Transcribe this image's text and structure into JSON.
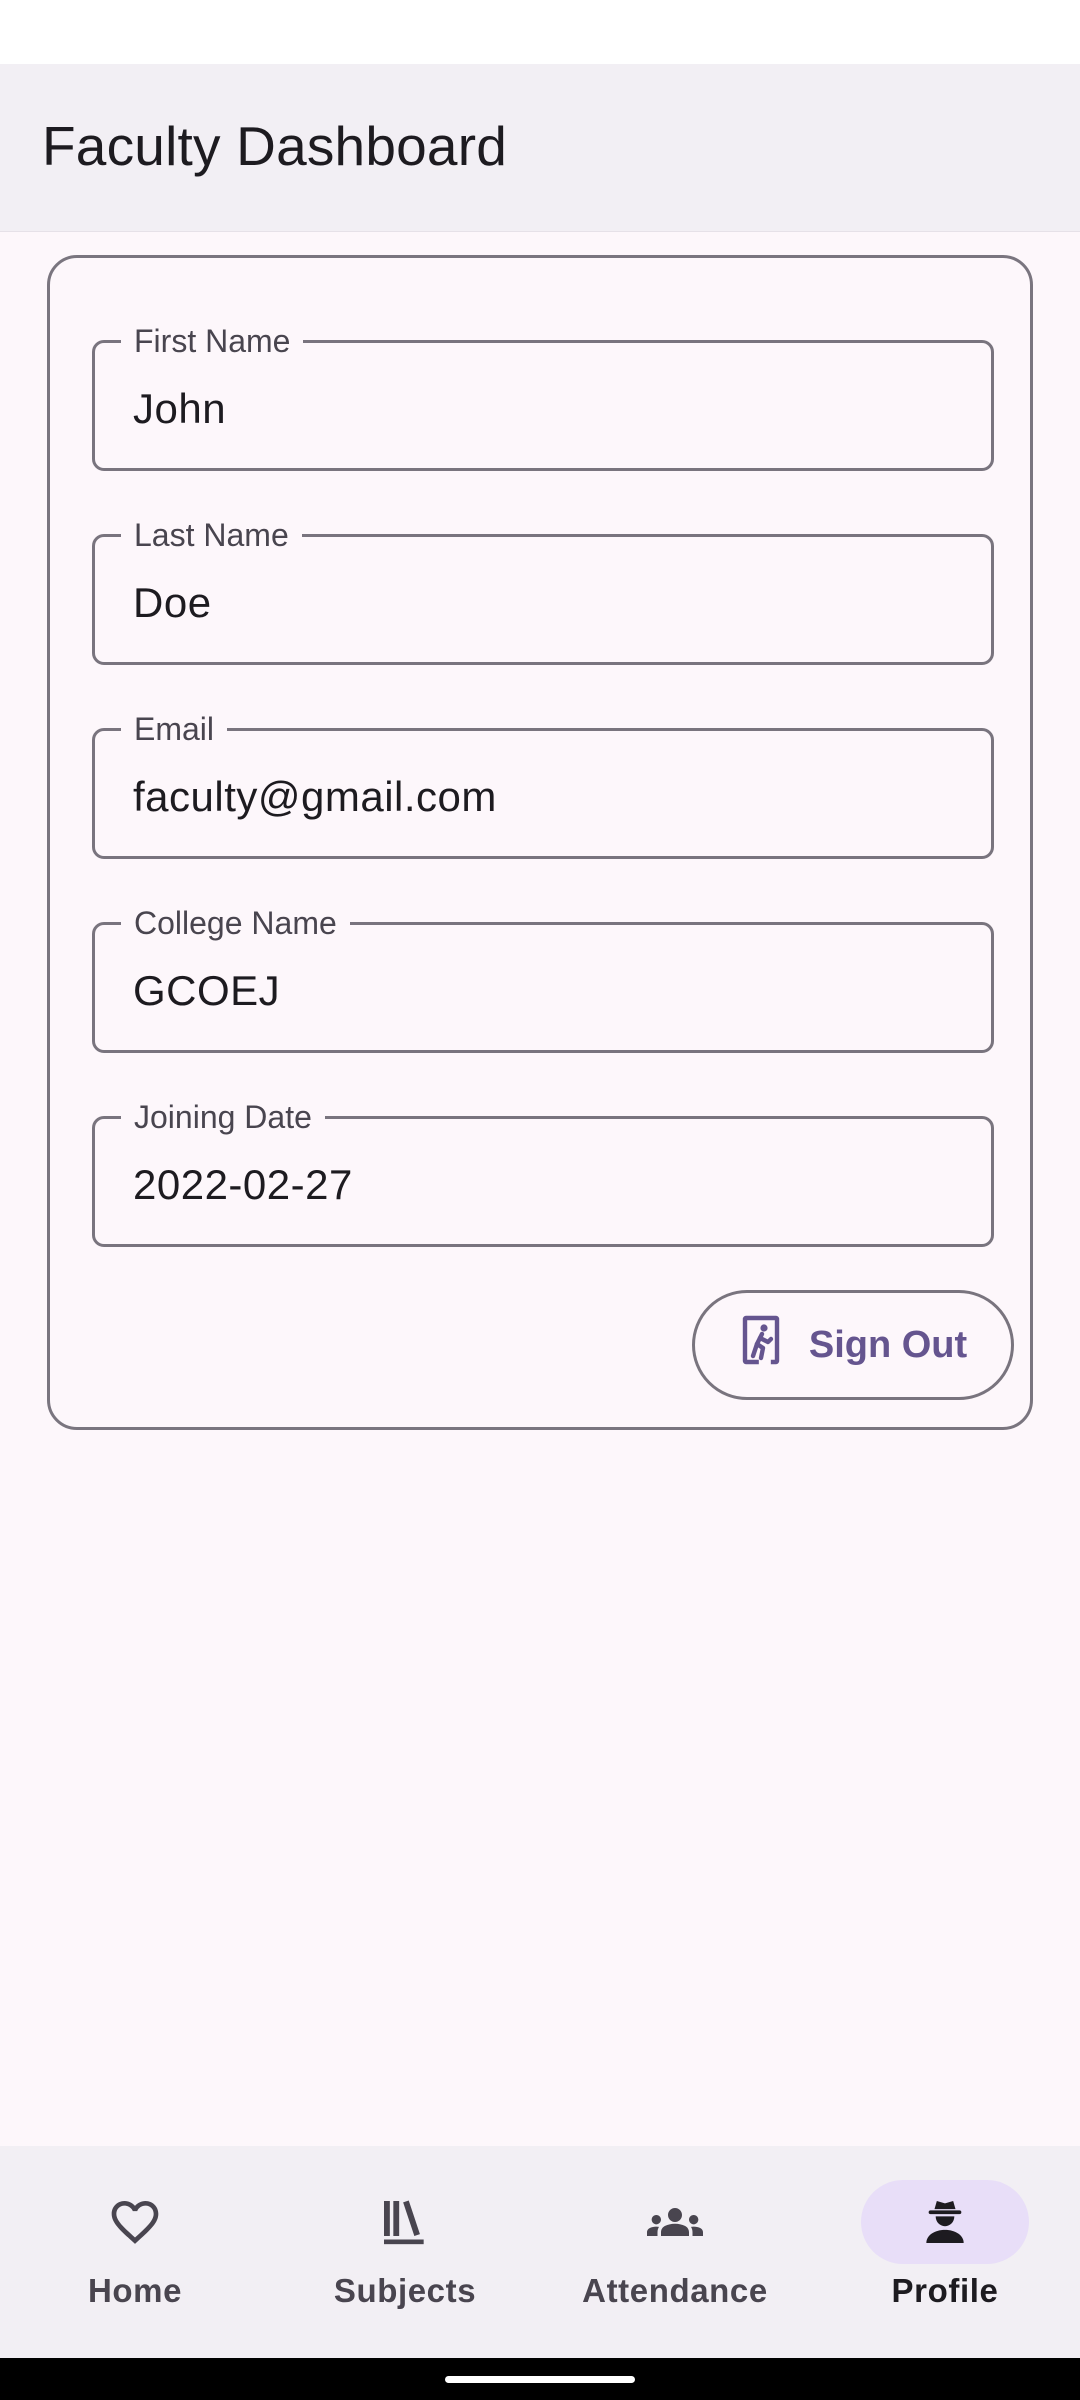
{
  "app_bar": {
    "title": "Faculty Dashboard"
  },
  "profile": {
    "fields": [
      {
        "label": "First Name",
        "value": "John"
      },
      {
        "label": "Last Name",
        "value": "Doe"
      },
      {
        "label": "Email",
        "value": "faculty@gmail.com"
      },
      {
        "label": "College Name",
        "value": "GCOEJ"
      },
      {
        "label": "Joining Date",
        "value": "2022-02-27"
      }
    ],
    "sign_out_label": "Sign Out"
  },
  "bottom_nav": {
    "items": [
      {
        "label": "Home",
        "icon": "heart-icon",
        "active": false
      },
      {
        "label": "Subjects",
        "icon": "books-icon",
        "active": false
      },
      {
        "label": "Attendance",
        "icon": "group-icon",
        "active": false
      },
      {
        "label": "Profile",
        "icon": "detective-icon",
        "active": true
      }
    ]
  },
  "colors": {
    "accent": "#65558f",
    "active_indicator": "#e8def8",
    "surface": "#fdf7fb",
    "app_bar": "#f2eff4"
  }
}
